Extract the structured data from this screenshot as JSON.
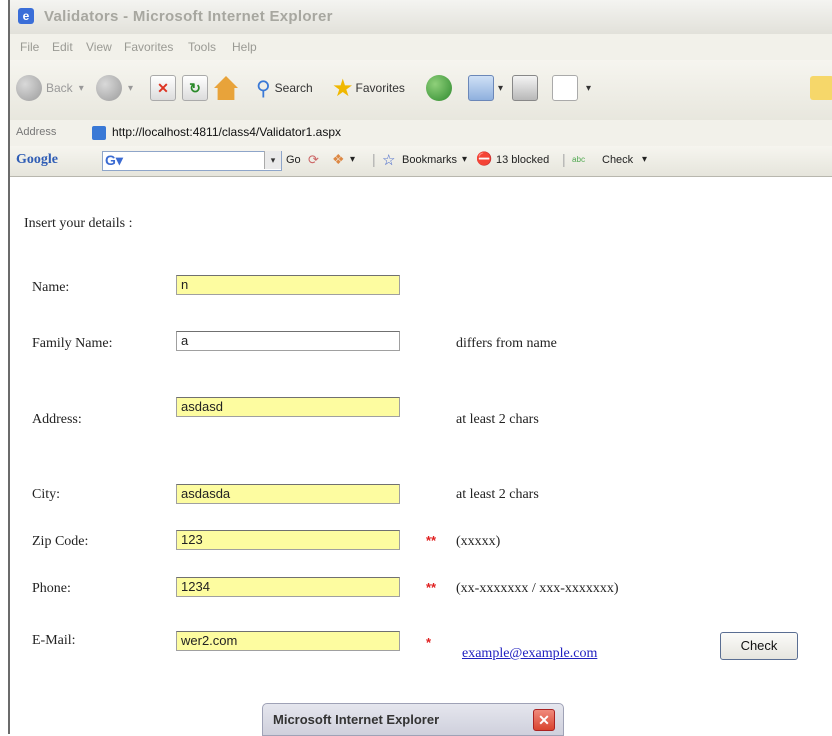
{
  "window": {
    "title": "Validators - Microsoft Internet Explorer"
  },
  "menu": [
    "File",
    "Edit",
    "View",
    "Favorites",
    "Tools",
    "Help"
  ],
  "toolbar": {
    "back": "Back",
    "search": "Search",
    "favorites": "Favorites"
  },
  "address": {
    "label": "Address",
    "url": "http://localhost:4811/class4/Validator1.aspx"
  },
  "googlebar": {
    "logo": "Google",
    "go": "Go",
    "bookmarks": "Bookmarks",
    "blocked": "13 blocked",
    "check": "Check"
  },
  "form": {
    "intro": "Insert your details :",
    "name_label": "Name:",
    "name_value": "n",
    "family_label": "Family Name:",
    "family_value": "a",
    "family_msg": "differs from name",
    "address_label": "Address:",
    "address_value": "asdasd",
    "address_msg": "at least 2 chars",
    "city_label": "City:",
    "city_value": "asdasda",
    "city_msg": "at least 2 chars",
    "zip_label": "Zip Code:",
    "zip_value": "123",
    "zip_req": "**",
    "zip_msg": "(xxxxx)",
    "phone_label": "Phone:",
    "phone_value": "1234",
    "phone_req": "**",
    "phone_msg": "(xx-xxxxxxx / xxx-xxxxxxx)",
    "email_label": "E-Mail:",
    "email_value": "wer2.com",
    "email_req": "*",
    "email_link": "example@example.com",
    "check_button": "Check"
  },
  "dialog": {
    "title": "Microsoft Internet Explorer"
  },
  "colors": {
    "invalid_field": "#fdfca0",
    "required_mark": "#e02020",
    "link": "#2020c0"
  }
}
